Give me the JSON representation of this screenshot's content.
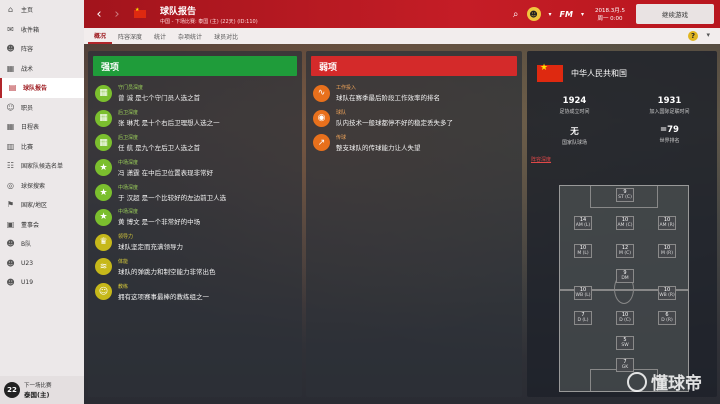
{
  "sidebar": {
    "items": [
      {
        "label": "主页",
        "icon": "home-icon",
        "glyph": "⌂"
      },
      {
        "label": "收件箱",
        "icon": "inbox-icon",
        "glyph": "✉"
      },
      {
        "label": "阵容",
        "icon": "squad-icon",
        "glyph": "☻"
      },
      {
        "label": "战术",
        "icon": "tactics-icon",
        "glyph": "▦"
      },
      {
        "label": "球队报告",
        "icon": "report-icon",
        "glyph": "▤",
        "active": true
      },
      {
        "label": "职员",
        "icon": "staff-icon",
        "glyph": "☺"
      },
      {
        "label": "日程表",
        "icon": "calendar-icon",
        "glyph": "▦"
      },
      {
        "label": "比赛",
        "icon": "match-icon",
        "glyph": "▥"
      },
      {
        "label": "国家队候选名单",
        "icon": "national-list-icon",
        "glyph": "☷"
      },
      {
        "label": "球探搜索",
        "icon": "scouting-icon",
        "glyph": "◎"
      },
      {
        "label": "国家/地区",
        "icon": "nation-icon",
        "glyph": "⚑"
      },
      {
        "label": "董事会",
        "icon": "board-icon",
        "glyph": "▣"
      },
      {
        "label": "B队",
        "icon": "b-team-icon",
        "glyph": "☻"
      },
      {
        "label": "U23",
        "icon": "u23-icon",
        "glyph": "☻"
      },
      {
        "label": "U19",
        "icon": "u19-icon",
        "glyph": "☻"
      }
    ],
    "bottom": {
      "clock": "22",
      "line1": "下一场比赛",
      "line2": "泰国(主)"
    }
  },
  "header": {
    "title": "球队报告",
    "subtitle": "中国 - 下场比赛: 泰国 (主) (22天) (ID:110)",
    "date_line1": "2018.3月.5",
    "date_line2": "周一 0:00",
    "continue": "继续游戏",
    "fm": "FM"
  },
  "tabs": [
    "概况",
    "阵容深度",
    "统计",
    "杂项统计",
    "球员对比"
  ],
  "strengths": {
    "title": "强项",
    "rows": [
      {
        "cat": "守门员深度",
        "desc": "曾 诚 是七个守门员人选之首",
        "icon": "grid-icon",
        "glyph": "▦"
      },
      {
        "cat": "后卫深度",
        "desc": "张 琳芃 是十个右后卫理想人选之一",
        "icon": "grid-icon",
        "glyph": "▦"
      },
      {
        "cat": "后卫深度",
        "desc": "任 航 是九个左后卫人选之首",
        "icon": "grid-icon",
        "glyph": "▦"
      },
      {
        "cat": "中场深度",
        "desc": "冯 潇霆 在中后卫位置表现非常好",
        "icon": "position-icon",
        "glyph": "★"
      },
      {
        "cat": "中场深度",
        "desc": "于 汉超 是一个比较好的左边前卫人选",
        "icon": "position-icon",
        "glyph": "★"
      },
      {
        "cat": "中场深度",
        "desc": "黄 博文 是一个非常好的中场",
        "icon": "position-icon",
        "glyph": "★"
      },
      {
        "cat": "领导力",
        "desc": "球队坚定而充满领导力",
        "icon": "leadership-icon",
        "glyph": "♛",
        "yellow": true
      },
      {
        "cat": "体能",
        "desc": "球队的弹跳力和制空能力非常出色",
        "icon": "jump-icon",
        "glyph": "≋",
        "yellow": true
      },
      {
        "cat": "教练",
        "desc": "拥有这项赛事最棒的教练组之一",
        "icon": "coach-icon",
        "glyph": "☺",
        "yellow": true
      }
    ]
  },
  "weaknesses": {
    "title": "弱项",
    "rows": [
      {
        "cat": "工作投入",
        "desc": "球队在赛季最后阶段工作效率的排名",
        "icon": "workrate-icon",
        "glyph": "∿"
      },
      {
        "cat": "球队",
        "desc": "队内技术一般球都停不好的稳定丢失多了",
        "icon": "ball-icon",
        "glyph": "◉"
      },
      {
        "cat": "传球",
        "desc": "整支球队的传球能力让人失望",
        "icon": "pass-icon",
        "glyph": "↗"
      }
    ]
  },
  "nation": {
    "name": "中华人民共和国",
    "stats": [
      {
        "value": "1924",
        "label": "足协成立时间"
      },
      {
        "value": "1931",
        "label": "加入国际足联时间"
      },
      {
        "value": "无",
        "label": "国家队球场"
      },
      {
        "value": "=79",
        "label": "世界排名"
      }
    ],
    "pitch_label": "阵容深度",
    "positions": [
      {
        "code": "ST (C)",
        "count": "9"
      },
      {
        "code": "AM (L)",
        "count": "14"
      },
      {
        "code": "AM (C)",
        "count": "10"
      },
      {
        "code": "AM (R)",
        "count": "10"
      },
      {
        "code": "M (L)",
        "count": "10"
      },
      {
        "code": "M (C)",
        "count": "12"
      },
      {
        "code": "M (R)",
        "count": "10"
      },
      {
        "code": "DM",
        "count": "9"
      },
      {
        "code": "WB (L)",
        "count": "10"
      },
      {
        "code": "WB (R)",
        "count": "10"
      },
      {
        "code": "D (L)",
        "count": "7"
      },
      {
        "code": "D (C)",
        "count": "10"
      },
      {
        "code": "D (R)",
        "count": "6"
      },
      {
        "code": "SW",
        "count": "5"
      },
      {
        "code": "GK",
        "count": "7"
      }
    ]
  },
  "watermark": "懂球帝",
  "colors": {
    "brand_red": "#c51d26",
    "strength_green": "#1f9c3a",
    "weakness_red": "#d42a2a"
  }
}
